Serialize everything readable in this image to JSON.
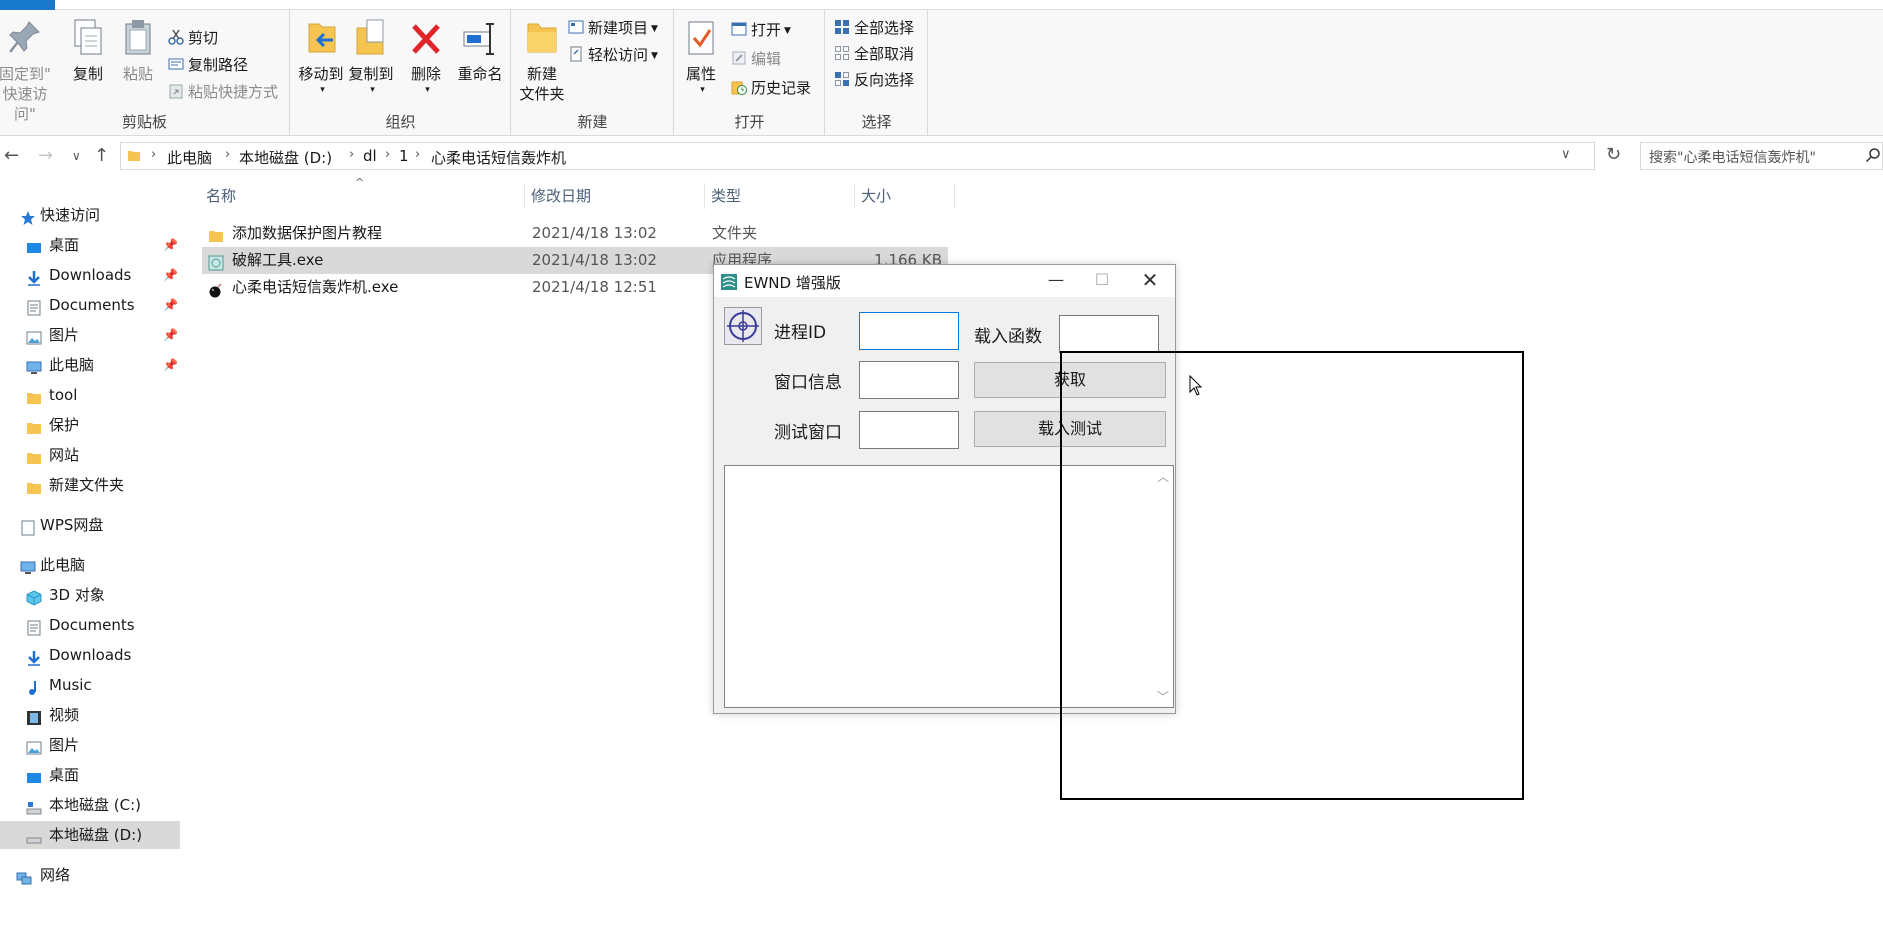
{
  "ribbon": {
    "clipboard": {
      "label": "剪贴板",
      "pin_label_1": "固定到\"",
      "pin_label_2": "快速访问\"",
      "copy": "复制",
      "paste": "粘贴",
      "cut": "剪切",
      "copy_path": "复制路径",
      "paste_shortcut": "粘贴快捷方式"
    },
    "organize": {
      "label": "组织",
      "move_to": "移动到",
      "copy_to": "复制到",
      "delete": "删除",
      "rename": "重命名"
    },
    "new": {
      "label": "新建",
      "new_folder_1": "新建",
      "new_folder_2": "文件夹",
      "new_item": "新建项目",
      "easy_access": "轻松访问"
    },
    "open": {
      "label": "打开",
      "properties": "属性",
      "open": "打开",
      "edit": "编辑",
      "history": "历史记录"
    },
    "select": {
      "label": "选择",
      "select_all": "全部选择",
      "select_none": "全部取消",
      "invert": "反向选择"
    }
  },
  "address": {
    "crumbs": [
      "此电脑",
      "本地磁盘 (D:)",
      "dl",
      "1",
      "心柔电话短信轰炸机"
    ],
    "search_placeholder": "搜索\"心柔电话短信轰炸机\""
  },
  "sidebar": {
    "quick_access": "快速访问",
    "quick_items": [
      "桌面",
      "Downloads",
      "Documents",
      "图片",
      "此电脑",
      "tool",
      "保护",
      "网站",
      "新建文件夹"
    ],
    "wps": "WPS网盘",
    "this_pc": "此电脑",
    "pc_items": [
      "3D 对象",
      "Documents",
      "Downloads",
      "Music",
      "视频",
      "图片",
      "桌面",
      "本地磁盘 (C:)",
      "本地磁盘 (D:)"
    ],
    "network": "网络"
  },
  "columns": {
    "name": "名称",
    "date": "修改日期",
    "type": "类型",
    "size": "大小"
  },
  "files": [
    {
      "name": "添加数据保护图片教程",
      "date": "2021/4/18 13:02",
      "type": "文件夹",
      "size": ""
    },
    {
      "name": "破解工具.exe",
      "date": "2021/4/18 13:02",
      "type": "应用程序",
      "size": "1,166 KB"
    },
    {
      "name": "心柔电话短信轰炸机.exe",
      "date": "2021/4/18 12:51",
      "type": "",
      "size": ""
    }
  ],
  "dialog": {
    "title": "EWND 增强版",
    "process_id_label": "进程ID",
    "load_function_label": "载入函数",
    "window_info_label": "窗口信息",
    "test_window_label": "测试窗口",
    "fetch_button": "获取",
    "load_test_button": "载入测试"
  }
}
